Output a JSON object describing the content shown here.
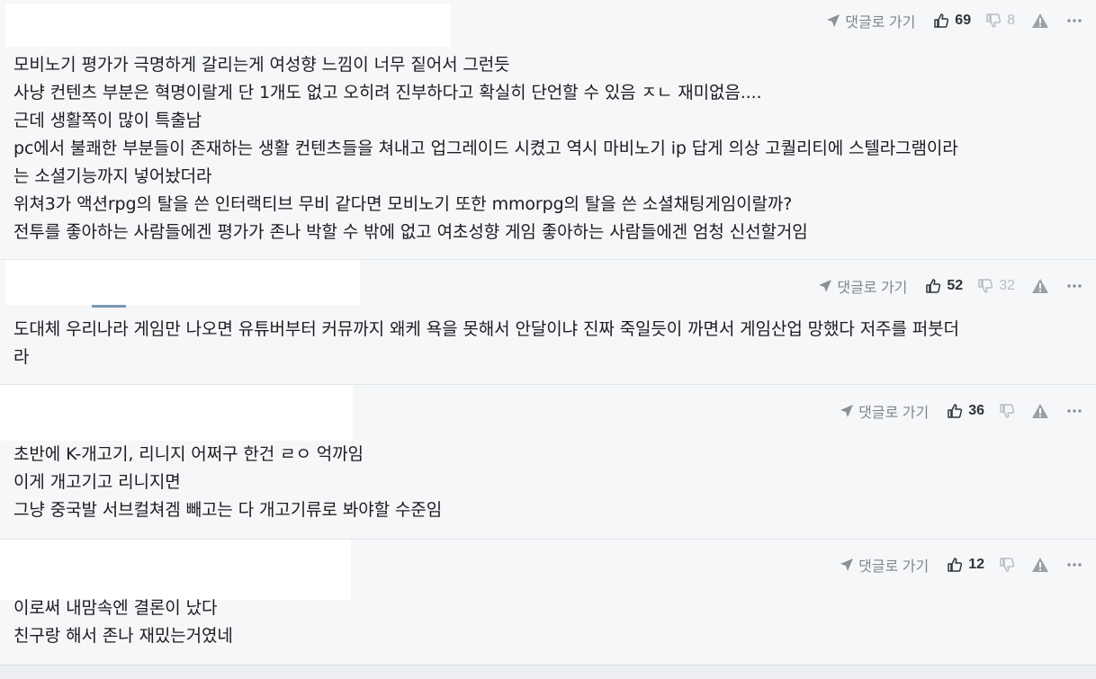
{
  "colors": {
    "background": "#f6f7f9",
    "text": "#1b1d20",
    "muted": "#8b9096",
    "divider": "#e3e6ea"
  },
  "comments": [
    {
      "reply_label": "댓글로 가기",
      "upvotes": "69",
      "downvotes": "8",
      "lines": [
        "모비노기 평가가 극명하게 갈리는게 여성향 느낌이 너무 짙어서 그런듯",
        "사냥 컨텐츠 부분은 혁명이랄게 단 1개도 없고 오히려 진부하다고 확실히 단언할 수 있음 ㅈㄴ 재미없음....",
        "근데 생활쪽이 많이 특출남",
        "pc에서 불쾌한 부분들이 존재하는 생활 컨텐츠들을 쳐내고 업그레이드 시켰고 역시 마비노기 ip 답게 의상 고퀄리티에 스텔라그램이라",
        "는 소셜기능까지 넣어놨더라",
        "위쳐3가 액션rpg의 탈을 쓴 인터랙티브 무비 같다면 모비노기 또한 mmorpg의 탈을 쓴 소셜채팅게임이랄까?",
        "전투를 좋아하는 사람들에겐 평가가 존나 박할 수 밖에 없고 여초성향 게임 좋아하는 사람들에겐 엄청 신선할거임"
      ]
    },
    {
      "reply_label": "댓글로 가기",
      "upvotes": "52",
      "downvotes": "32",
      "lines": [
        "도대체 우리나라 게임만 나오면 유튜버부터 커뮤까지 왜케 욕을 못해서 안달이냐 진짜 죽일듯이 까면서 게임산업 망했다 저주를 퍼붓더",
        "라"
      ]
    },
    {
      "reply_label": "댓글로 가기",
      "upvotes": "36",
      "downvotes": "",
      "lines": [
        "초반에 K-개고기, 리니지 어쩌구 한건 ㄹㅇ 억까임",
        "이게 개고기고 리니지면",
        "그냥 중국발 서브컬쳐겜 빼고는 다 개고기류로 봐야할 수준임"
      ]
    },
    {
      "reply_label": "댓글로 가기",
      "upvotes": "12",
      "downvotes": "",
      "lines": [
        "이로써 내맘속엔 결론이 났다",
        "친구랑 해서 존나 재밌는거였네"
      ]
    }
  ]
}
